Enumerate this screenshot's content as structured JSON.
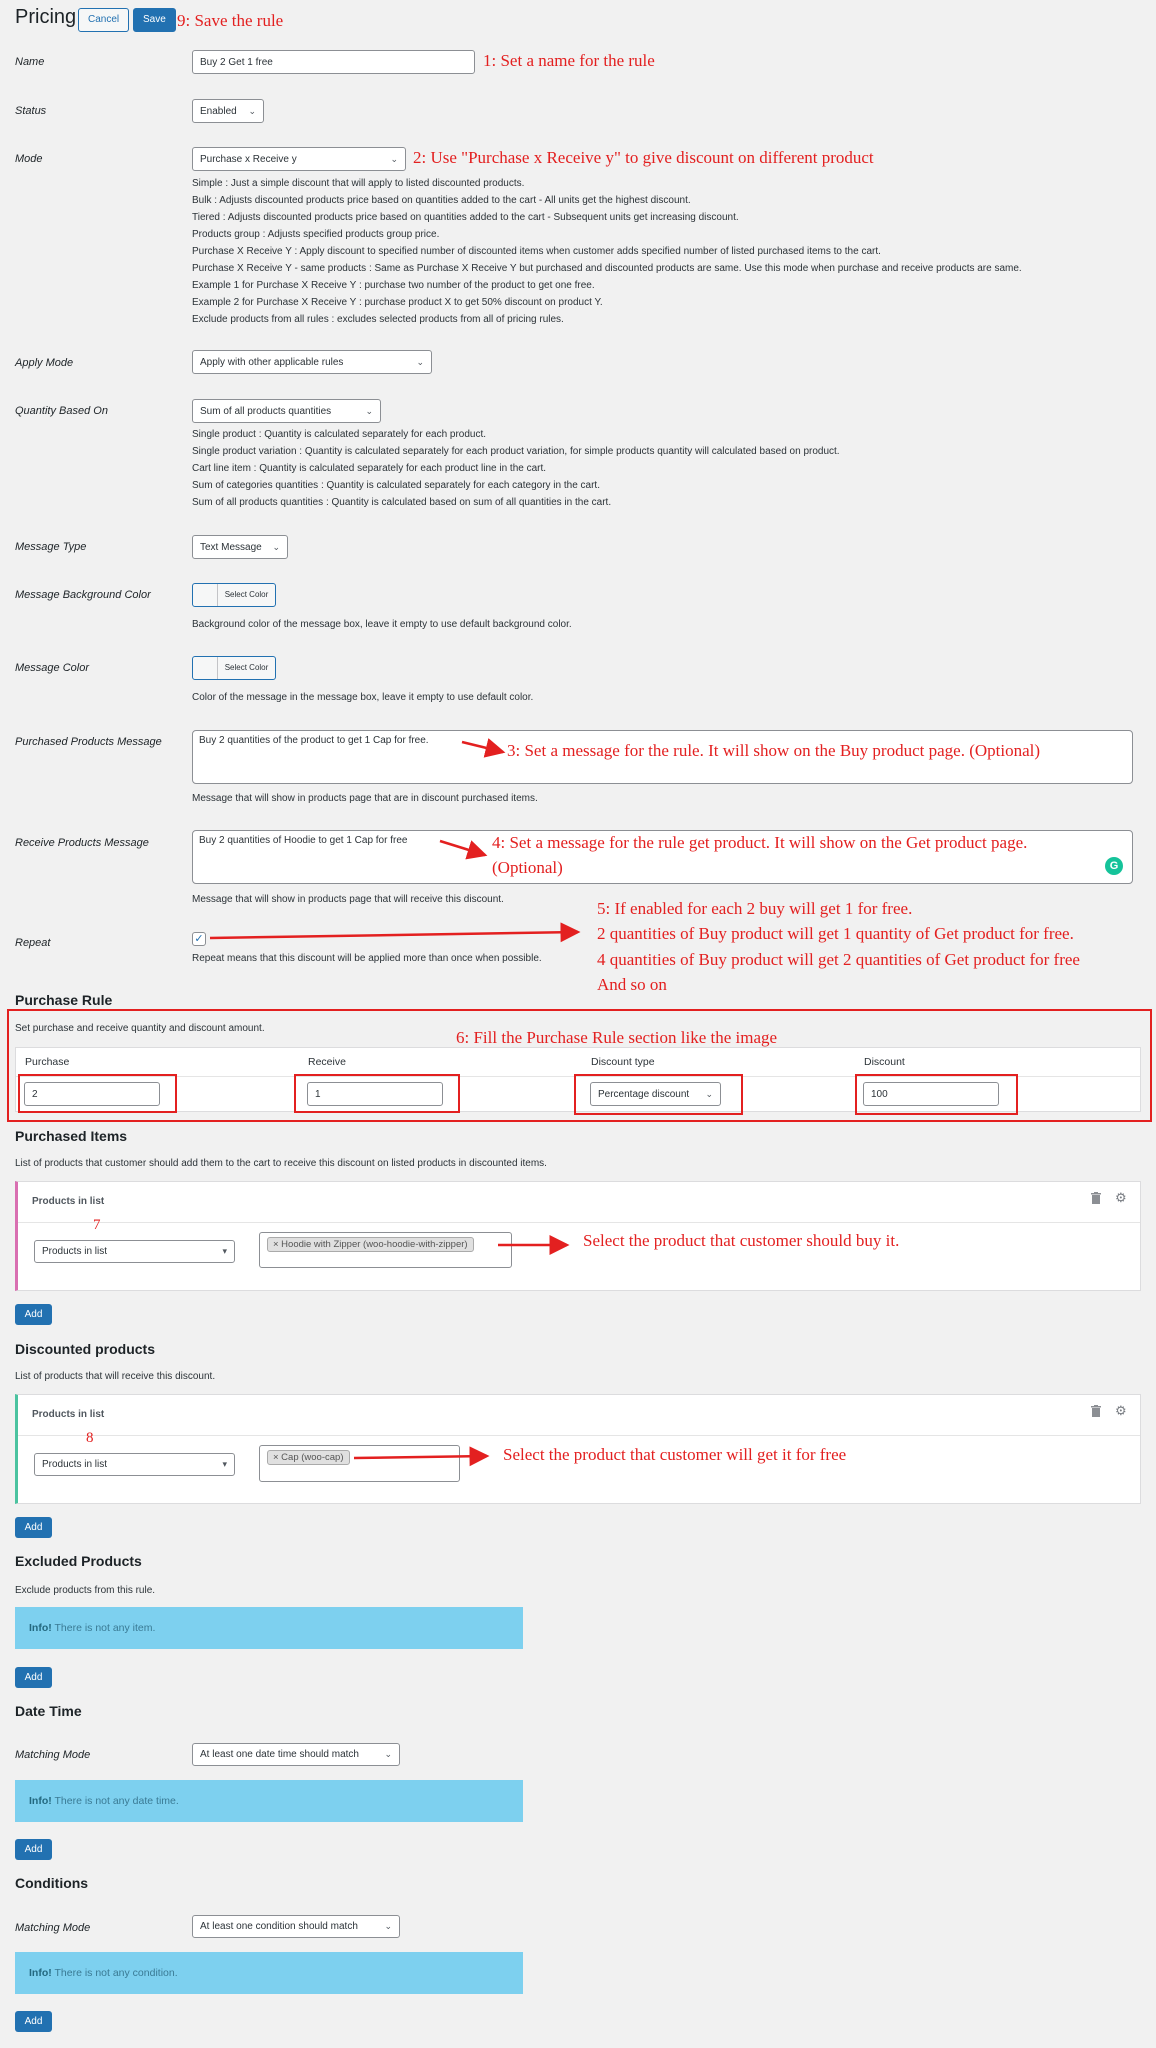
{
  "header": {
    "title": "Pricing",
    "cancel_label": "Cancel",
    "save_label": "Save"
  },
  "annotations": {
    "save": "9: Save the rule",
    "name": "1: Set a name for the rule",
    "mode": "2: Use \"Purchase x Receive y\" to give discount on different product",
    "purchased_msg": "3: Set a message for the rule. It will show on the Buy product page. (Optional)",
    "receive_msg_1": "4: Set a message for the rule get product. It will show on the Get product page.",
    "receive_msg_2": "(Optional)",
    "repeat_1": "5: If enabled for each 2 buy will get 1 for free.",
    "repeat_2": "2 quantities of Buy product will get 1 quantity of Get product for free.",
    "repeat_3": "4 quantities of Buy product will get 2 quantities of Get product for free",
    "repeat_4": "And so on",
    "purchase_rule": "6: Fill the Purchase Rule section like the image",
    "num7": "7",
    "purchased_items": "Select the product that customer should buy it.",
    "num8": "8",
    "discounted_products": "Select the product that customer will get it for free"
  },
  "fields": {
    "name": {
      "label": "Name",
      "value": "Buy 2 Get 1 free"
    },
    "status": {
      "label": "Status",
      "value": "Enabled"
    },
    "mode": {
      "label": "Mode",
      "value": "Purchase x Receive y",
      "desc": [
        "Simple : Just a simple discount that will apply to listed discounted products.",
        "Bulk : Adjusts discounted products price based on quantities added to the cart - All units get the highest discount.",
        "Tiered : Adjusts discounted products price based on quantities added to the cart - Subsequent units get increasing discount.",
        "Products group : Adjusts specified products group price.",
        "Purchase X Receive Y : Apply discount to specified number of discounted items when customer adds specified number of listed purchased items to the cart.",
        "Purchase X Receive Y - same products : Same as Purchase X Receive Y but purchased and discounted products are same. Use this mode when purchase and receive products are same.",
        "Example 1 for Purchase X Receive Y : purchase two number of the product to get one free.",
        "Example 2 for Purchase X Receive Y : purchase product X to get 50% discount on product Y.",
        "Exclude products from all rules : excludes selected products from all of pricing rules."
      ]
    },
    "apply_mode": {
      "label": "Apply Mode",
      "value": "Apply with other applicable rules"
    },
    "quantity_based_on": {
      "label": "Quantity Based On",
      "value": "Sum of all products quantities",
      "desc": [
        "Single product : Quantity is calculated separately for each product.",
        "Single product variation : Quantity is calculated separately for each product variation, for simple products quantity will calculated based on product.",
        "Cart line item : Quantity is calculated separately for each product line in the cart.",
        "Sum of categories quantities : Quantity is calculated separately for each category in the cart.",
        "Sum of all products quantities : Quantity is calculated based on sum of all quantities in the cart."
      ]
    },
    "message_type": {
      "label": "Message Type",
      "value": "Text Message"
    },
    "message_bg": {
      "label": "Message Background Color",
      "button": "Select Color",
      "desc": "Background color of the message box, leave it empty to use default background color."
    },
    "message_color": {
      "label": "Message Color",
      "button": "Select Color",
      "desc": "Color of the message in the message box, leave it empty to use default color."
    },
    "purchased_msg": {
      "label": "Purchased Products Message",
      "value": "Buy 2 quantities of the product to get 1 Cap for free.",
      "desc": "Message that will show in products page that are in discount purchased items."
    },
    "receive_msg": {
      "label": "Receive Products Message",
      "value": "Buy 2 quantities of Hoodie to get 1 Cap for free",
      "desc": "Message that will show in products page that will receive this discount."
    },
    "repeat": {
      "label": "Repeat",
      "checked": "✓",
      "desc": "Repeat means that this discount will be applied more than once when possible."
    }
  },
  "purchase_rule": {
    "title": "Purchase Rule",
    "desc": "Set purchase and receive quantity and discount amount.",
    "headers": [
      "Purchase",
      "Receive",
      "Discount type",
      "Discount"
    ],
    "purchase": "2",
    "receive": "1",
    "discount_type": "Percentage discount",
    "discount": "100"
  },
  "purchased_items": {
    "title": "Purchased Items",
    "desc": "List of products that customer should add them to the cart to receive this discount on listed products in discounted items.",
    "panel_title": "Products in list",
    "select": "Products in list",
    "tag": "× Hoodie with Zipper (woo-hoodie-with-zipper)",
    "add": "Add"
  },
  "discounted_products": {
    "title": "Discounted products",
    "desc": "List of products that will receive this discount.",
    "panel_title": "Products in list",
    "select": "Products in list",
    "tag": "× Cap (woo-cap)",
    "add": "Add"
  },
  "excluded_products": {
    "title": "Excluded Products",
    "desc": "Exclude products from this rule.",
    "info_bold": "Info!",
    "info_text": " There is not any item.",
    "add": "Add"
  },
  "date_time": {
    "title": "Date Time",
    "label": "Matching Mode",
    "value": "At least one date time should match",
    "info_bold": "Info!",
    "info_text": " There is not any date time.",
    "add": "Add"
  },
  "conditions": {
    "title": "Conditions",
    "label": "Matching Mode",
    "value": "At least one condition should match",
    "info_bold": "Info!",
    "info_text": " There is not any condition.",
    "add": "Add"
  },
  "icons": {
    "trash": "trash-icon",
    "gear": "gear-icon",
    "chevron": "chevron-down-icon",
    "grammarly": "grammarly-icon"
  },
  "colors": {
    "accent": "#2271b1",
    "annotation": "#e32020",
    "info_bg": "#7dd0ef",
    "purchased_bar": "#d96fb1",
    "discounted_bar": "#4bc3a0"
  }
}
